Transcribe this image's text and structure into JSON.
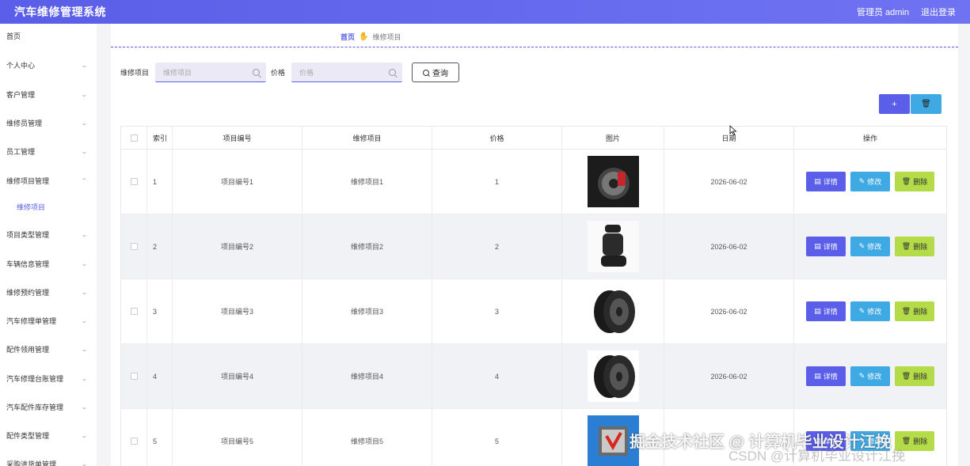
{
  "app": {
    "title": "汽车维修管理系统",
    "user": "管理员 admin",
    "logout": "退出登录"
  },
  "sidebar": {
    "home": "首页",
    "items": [
      {
        "label": "个人中心"
      },
      {
        "label": "客户管理"
      },
      {
        "label": "维修员管理"
      },
      {
        "label": "员工管理"
      },
      {
        "label": "维修项目管理"
      },
      {
        "label": "项目类型管理"
      },
      {
        "label": "车辆信息管理"
      },
      {
        "label": "维修预约管理"
      },
      {
        "label": "汽车修理单管理"
      },
      {
        "label": "配件领用管理"
      },
      {
        "label": "汽车修理台账管理"
      },
      {
        "label": "汽车配件库存管理"
      },
      {
        "label": "配件类型管理"
      },
      {
        "label": "采购进货单管理"
      }
    ],
    "sub_item": "维修项目"
  },
  "breadcrumb": {
    "home": "首页",
    "current": "维修项目"
  },
  "search": {
    "item_label": "维修项目",
    "item_placeholder": "维修项目",
    "price_label": "价格",
    "price_placeholder": "价格",
    "query": "查询"
  },
  "toolbar": {
    "add_icon": "plus-icon",
    "delete_icon": "trash-icon"
  },
  "table": {
    "headers": {
      "index": "索引",
      "code": "项目编号",
      "item": "维修项目",
      "price": "价格",
      "image": "图片",
      "date": "日期",
      "ops": "操作"
    },
    "ops": {
      "detail": "详情",
      "edit": "修改",
      "delete": "删除"
    },
    "rows": [
      {
        "index": "1",
        "code": "项目编号1",
        "item": "维修项目1",
        "price": "1",
        "image": "brake-disc-image",
        "date": "2026-06-02"
      },
      {
        "index": "2",
        "code": "项目编号2",
        "item": "维修项目2",
        "price": "2",
        "image": "car-seat-image",
        "date": "2026-06-02"
      },
      {
        "index": "3",
        "code": "项目编号3",
        "item": "维修项目3",
        "price": "3",
        "image": "tire-image",
        "date": "2026-06-02"
      },
      {
        "index": "4",
        "code": "项目编号4",
        "item": "维修项目4",
        "price": "4",
        "image": "tire-image",
        "date": "2026-06-02"
      },
      {
        "index": "5",
        "code": "项目编号5",
        "item": "维修项目5",
        "price": "5",
        "image": "chip-image",
        "date": ""
      }
    ]
  },
  "watermark": {
    "main": "掘金技术社区 @ 计算机毕业设计江挽",
    "sub": "CSDN @计算机毕业设计江挽"
  },
  "colors": {
    "primary": "#5a5ee8",
    "info": "#3fa9e4",
    "success": "#b4db48"
  }
}
